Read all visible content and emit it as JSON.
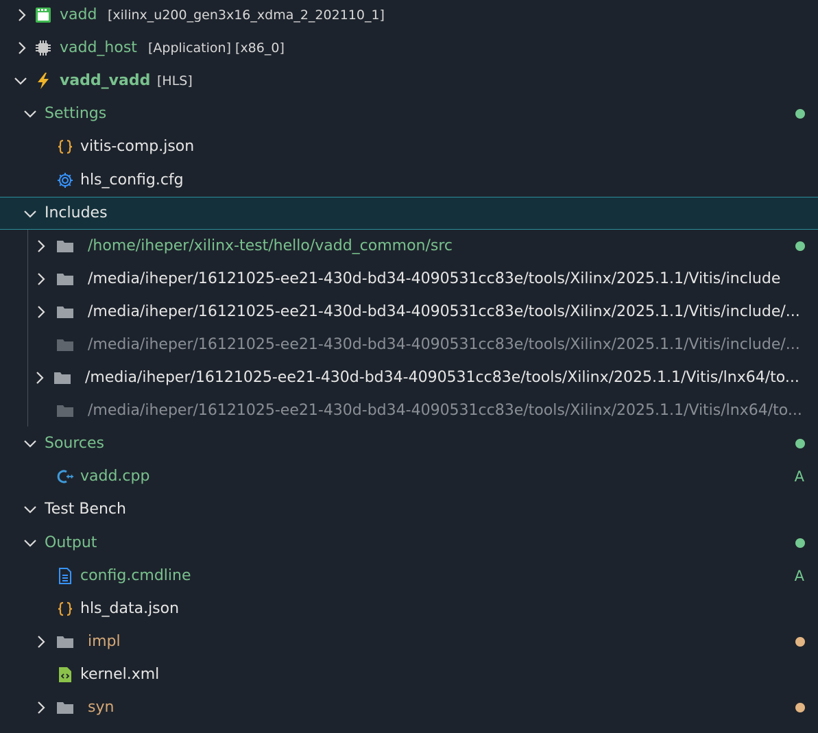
{
  "colors": {
    "background": "#1d232c",
    "selected_background": "#14313b",
    "selected_border": "#2c8f9c",
    "git_added_green": "#79c28e",
    "dot_green": "#73c991",
    "dot_orange": "#e2b583",
    "ignored_gray": "#8a8f96",
    "json_orange": "#e5a43a",
    "config_blue": "#3794ff",
    "cpp_blue": "#3f9bdc",
    "xml_green": "#8bc34a",
    "folder_gray": "#9aa0a6"
  },
  "tree": {
    "platform": {
      "name": "vadd",
      "description": "[xilinx_u200_gen3x16_xdma_2_202110_1]",
      "icon": "platform-icon"
    },
    "host": {
      "name": "vadd_host",
      "description": "[Application] [x86_0]",
      "icon": "chip-icon"
    },
    "hls_component": {
      "name": "vadd_vadd",
      "description": "[HLS]",
      "icon": "lightning-icon"
    },
    "settings": {
      "label": "Settings",
      "files": [
        {
          "name": "vitis-comp.json",
          "icon": "json-braces-icon"
        },
        {
          "name": "hls_config.cfg",
          "icon": "gear-icon"
        }
      ]
    },
    "includes": {
      "label": "Includes",
      "paths": [
        "/home/iheper/xilinx-test/hello/vadd_common/src",
        "/media/iheper/16121025-ee21-430d-bd34-4090531cc83e/tools/Xilinx/2025.1.1/Vitis/include",
        "/media/iheper/16121025-ee21-430d-bd34-4090531cc83e/tools/Xilinx/2025.1.1/Vitis/include/...",
        "/media/iheper/16121025-ee21-430d-bd34-4090531cc83e/tools/Xilinx/2025.1.1/Vitis/include/...",
        "/media/iheper/16121025-ee21-430d-bd34-4090531cc83e/tools/Xilinx/2025.1.1/Vitis/lnx64/to...",
        "/media/iheper/16121025-ee21-430d-bd34-4090531cc83e/tools/Xilinx/2025.1.1/Vitis/lnx64/to..."
      ]
    },
    "sources": {
      "label": "Sources",
      "files": [
        {
          "name": "vadd.cpp",
          "icon": "cpp-icon",
          "badge": "A"
        }
      ]
    },
    "test_bench": {
      "label": "Test Bench"
    },
    "output": {
      "label": "Output",
      "items": [
        {
          "name": "config.cmdline",
          "icon": "document-icon",
          "badge": "A"
        },
        {
          "name": "hls_data.json",
          "icon": "json-braces-icon"
        },
        {
          "name": "impl",
          "icon": "folder-icon"
        },
        {
          "name": "kernel.xml",
          "icon": "xml-file-icon"
        },
        {
          "name": "syn",
          "icon": "folder-icon"
        }
      ]
    }
  }
}
